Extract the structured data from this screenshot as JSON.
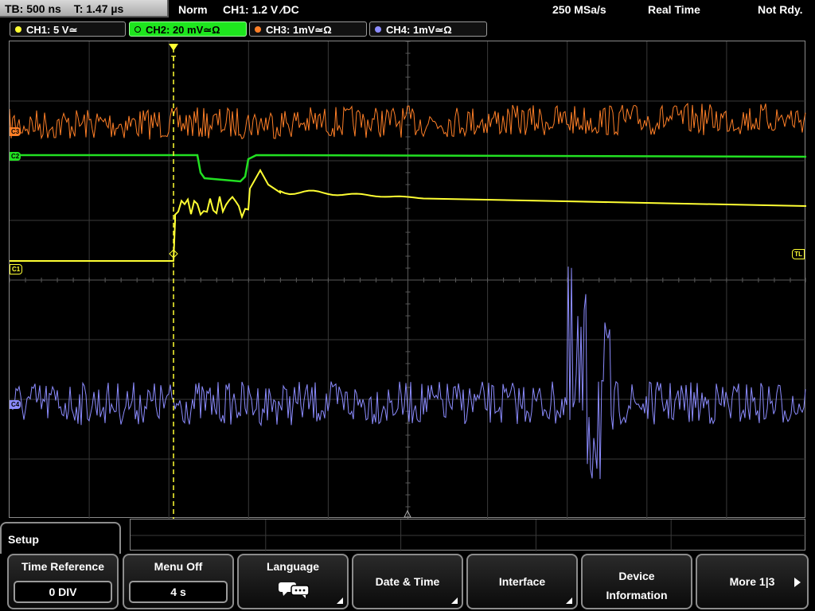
{
  "status": {
    "timebase": "TB: 500 ns",
    "trigger_time": "T: 1.47 µs",
    "mode": "Norm",
    "trigger_info": "CH1: 1.2 V ∕DC",
    "sample_rate": "250 MSa/s",
    "acq_mode": "Real Time",
    "trigger_state": "Not Rdy."
  },
  "channels": [
    {
      "label": "CH1: 5 V≃",
      "color": "#ffff33"
    },
    {
      "label": "CH2: 20 mV≃Ω",
      "color": "#22e022"
    },
    {
      "label": "CH3: 1mV≃Ω",
      "color": "#ff7f27"
    },
    {
      "label": "CH4: 1mV≃Ω",
      "color": "#8c8cff"
    }
  ],
  "markers": {
    "c1": "C1",
    "c2": "C2",
    "c3": "C3",
    "c4": "C4",
    "trigger_level": "TL",
    "trigger_pos": "T"
  },
  "menu": {
    "title": "Setup",
    "keys": [
      {
        "label": "Time Reference",
        "value": "0 DIV"
      },
      {
        "label": "Menu Off",
        "value": "4 s"
      },
      {
        "label": "Language",
        "icon": "speech-bubbles-icon"
      },
      {
        "label": "Date & Time"
      },
      {
        "label": "Interface"
      },
      {
        "label": "Device Information"
      },
      {
        "label": "More 1|3"
      }
    ]
  }
}
